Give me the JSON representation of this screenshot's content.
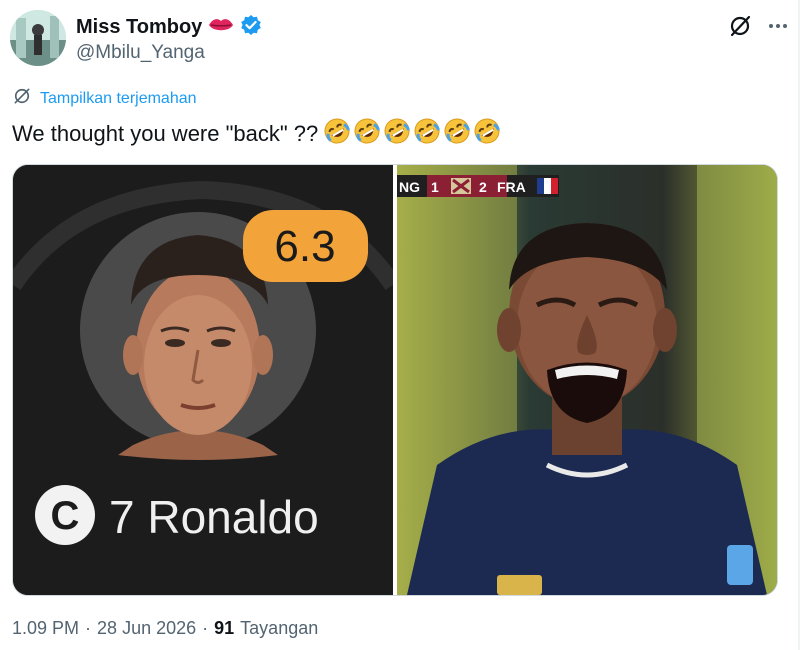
{
  "tweet": {
    "author": {
      "display_name": "Miss Tomboy",
      "handle": "@Mbilu_Yanga",
      "verified": true,
      "name_emoji": "lips-icon"
    },
    "translate_label": "Tampilkan terjemahan",
    "text": "We thought you were \"back\" ??",
    "emoji": [
      "rofl-icon",
      "rofl-icon",
      "rofl-icon",
      "rofl-icon",
      "rofl-icon",
      "rofl-icon"
    ],
    "media": {
      "left": {
        "rating": "6.3",
        "player_label": "7 Ronaldo",
        "captain_badge": "C"
      },
      "right": {
        "scoreboard": {
          "team1": "NG",
          "score1": "1",
          "score2": "2",
          "team2": "FRA"
        }
      }
    },
    "meta": {
      "time": "1.09 PM",
      "date": "28 Jun 2026",
      "views": "91",
      "views_label": "Tayangan",
      "separator": "·"
    }
  },
  "colors": {
    "accent": "#1d9bf0",
    "text_primary": "#0f1419",
    "text_secondary": "#536471",
    "rating_badge": "#f2a33a"
  }
}
